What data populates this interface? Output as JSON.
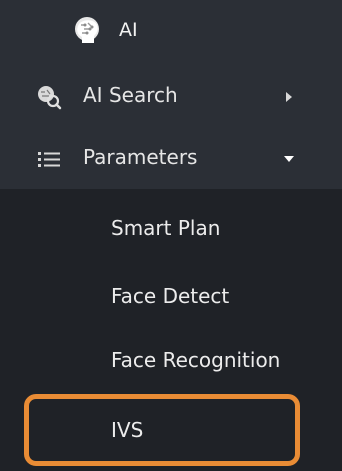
{
  "header": {
    "title": "AI",
    "icon": "ai-head-icon"
  },
  "menu": {
    "ai_search": {
      "label": "AI Search",
      "icon": "ai-search-icon",
      "caret": "chevron-right-icon"
    },
    "parameters": {
      "label": "Parameters",
      "icon": "list-icon",
      "caret": "chevron-down-icon",
      "expanded": true
    },
    "sub_items": [
      {
        "label": "Smart Plan"
      },
      {
        "label": "Face Detect"
      },
      {
        "label": "Face Recognition"
      },
      {
        "label": "IVS"
      }
    ]
  },
  "colors": {
    "menu_background": "#2b2f36",
    "submenu_background": "#1f2227",
    "text": "#e6e6e6",
    "highlight_border": "#e98c35"
  }
}
